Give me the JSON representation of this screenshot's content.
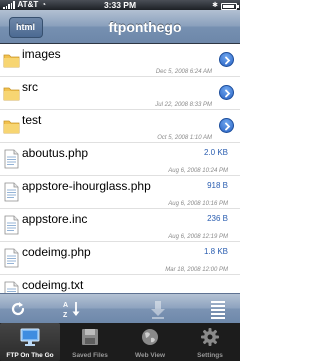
{
  "status_bar": {
    "carrier": "AT&T",
    "time": "3:33 PM"
  },
  "nav": {
    "back_label": "html",
    "title": "ftponthego"
  },
  "files": [
    {
      "kind": "folder",
      "name": "images",
      "date": "Dec 5, 2008 6:24 AM",
      "size": ""
    },
    {
      "kind": "folder",
      "name": "src",
      "date": "Jul 22, 2008 8:33 PM",
      "size": ""
    },
    {
      "kind": "folder",
      "name": "test",
      "date": "Oct 5, 2008 1:10 AM",
      "size": ""
    },
    {
      "kind": "file",
      "name": "aboutus.php",
      "date": "Aug 6, 2008 10:24 PM",
      "size": "2.0 KB"
    },
    {
      "kind": "file",
      "name": "appstore-ihourglass.php",
      "date": "Aug 6, 2008 10:16 PM",
      "size": "918 B"
    },
    {
      "kind": "file",
      "name": "appstore.inc",
      "date": "Aug 6, 2008 12:19 PM",
      "size": "236 B"
    },
    {
      "kind": "file",
      "name": "codeimg.php",
      "date": "Mar 18, 2008 12:00 PM",
      "size": "1.8 KB"
    },
    {
      "kind": "file",
      "name": "codeimg.txt",
      "date": "",
      "size": ""
    }
  ],
  "toolbar": {
    "icons": [
      "refresh-icon",
      "sort-icon",
      "download-icon",
      "list-icon"
    ]
  },
  "tabs": [
    {
      "label": "FTP On The Go",
      "icon": "monitor-icon",
      "selected": true
    },
    {
      "label": "Saved Files",
      "icon": "disk-icon",
      "selected": false
    },
    {
      "label": "Web View",
      "icon": "globe-icon",
      "selected": false
    },
    {
      "label": "Settings",
      "icon": "gear-icon",
      "selected": false
    }
  ],
  "colors": {
    "nav_bar": "#8aa0bd",
    "size_text": "#2a5db0",
    "folder": "#f2c14e",
    "tab_bar": "#1c1c1c"
  }
}
